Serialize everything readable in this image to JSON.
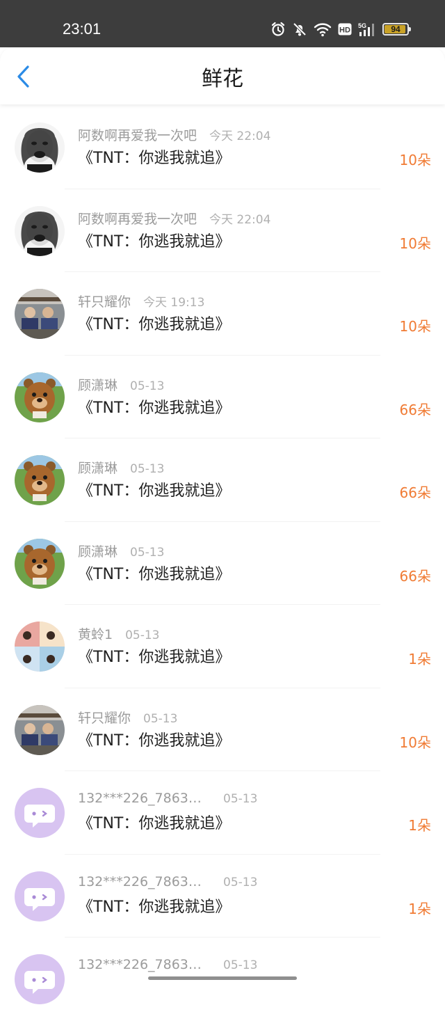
{
  "status_bar": {
    "time": "23:01",
    "icons": [
      "alarm-icon",
      "do-not-disturb-icon",
      "wifi-icon",
      "hd-icon",
      "signal-5g-icon",
      "battery-icon"
    ],
    "hd_label": "HD",
    "network_label": "5G",
    "battery_level": "94",
    "battery_color": "#c9a227"
  },
  "header": {
    "title": "鲜花",
    "back_icon": "chevron-left-icon",
    "accent_color": "#2b8be6"
  },
  "gifts": [
    {
      "user": "阿数啊再爱我一次吧",
      "time": "今天 22:04",
      "message": "《TNT：你逃我就追》",
      "count": "10朵",
      "avatar": "meme-face-avatar"
    },
    {
      "user": "阿数啊再爱我一次吧",
      "time": "今天 22:04",
      "message": "《TNT：你逃我就追》",
      "count": "10朵",
      "avatar": "meme-face-avatar"
    },
    {
      "user": "轩只耀你",
      "time": "今天 19:13",
      "message": "《TNT：你逃我就追》",
      "count": "10朵",
      "avatar": "group-photo-avatar"
    },
    {
      "user": "顾潇琳",
      "time": "05-13",
      "message": "《TNT：你逃我就追》",
      "count": "66朵",
      "avatar": "bear-cartoon-avatar"
    },
    {
      "user": "顾潇琳",
      "time": "05-13",
      "message": "《TNT：你逃我就追》",
      "count": "66朵",
      "avatar": "bear-cartoon-avatar"
    },
    {
      "user": "顾潇琳",
      "time": "05-13",
      "message": "《TNT：你逃我就追》",
      "count": "66朵",
      "avatar": "bear-cartoon-avatar"
    },
    {
      "user": "黄蛉1",
      "time": "05-13",
      "message": "《TNT：你逃我就追》",
      "count": "1朵",
      "avatar": "collage-avatar"
    },
    {
      "user": "轩只耀你",
      "time": "05-13",
      "message": "《TNT：你逃我就追》",
      "count": "10朵",
      "avatar": "group-photo-avatar"
    },
    {
      "user": "132***226_78631...",
      "time": "05-13",
      "message": "《TNT：你逃我就追》",
      "count": "1朵",
      "avatar": "default-chat-avatar"
    },
    {
      "user": "132***226_78631...",
      "time": "05-13",
      "message": "《TNT：你逃我就追》",
      "count": "1朵",
      "avatar": "default-chat-avatar"
    },
    {
      "user": "132***226_78631...",
      "time": "05-13",
      "message": "",
      "count": "",
      "avatar": "default-chat-avatar"
    }
  ],
  "colors": {
    "count": "#f07b34",
    "default_avatar": "#d8c4f1"
  }
}
